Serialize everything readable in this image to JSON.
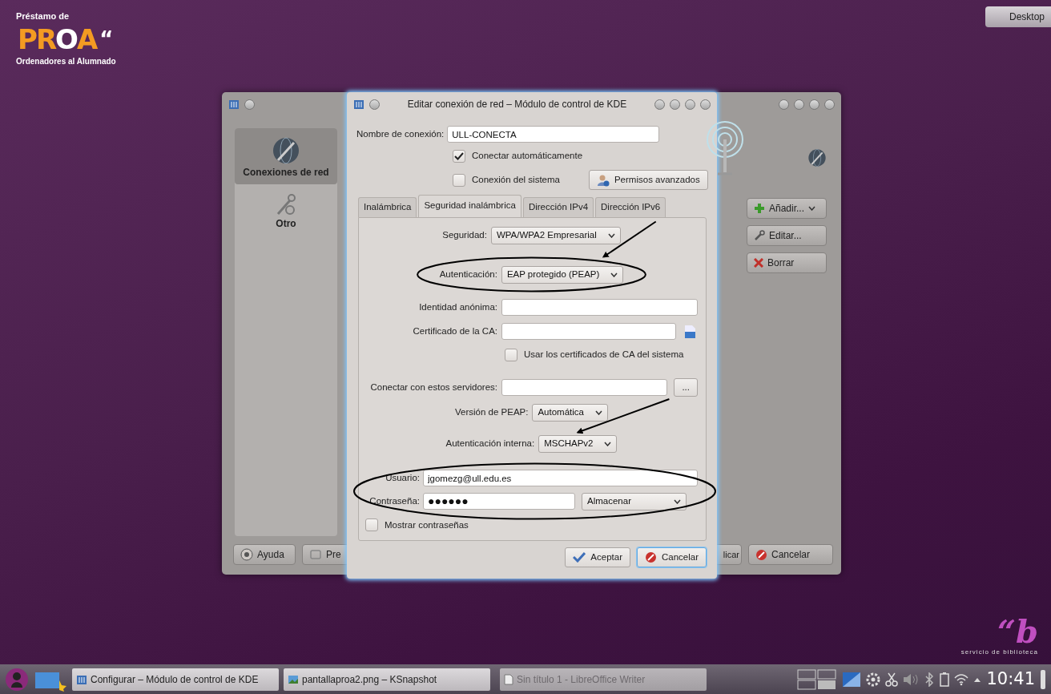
{
  "desktop": {
    "logo": {
      "top_line": "Préstamo de",
      "mark": [
        {
          "text": "PR",
          "color": "#f39b22"
        },
        {
          "text": "O",
          "color": "#ffffff"
        },
        {
          "text": "A",
          "color": "#f39b22"
        }
      ],
      "quote": "“",
      "bottom_line": "Ordenadores al Alumnado"
    },
    "show_desktop": "Desktop",
    "library_logo": {
      "mark": "“b",
      "caption": "servicio de biblioteca"
    }
  },
  "settings_window": {
    "sidebar": [
      {
        "label": "Conexiones de red",
        "kind": "network",
        "selected": true
      },
      {
        "label": "Otro",
        "kind": "tools",
        "selected": false
      }
    ],
    "actions": [
      {
        "label": "Añadir...",
        "kind": "add"
      },
      {
        "label": "Editar...",
        "kind": "edit"
      },
      {
        "label": "Borrar",
        "kind": "delete"
      }
    ],
    "footer_left": [
      {
        "label": "Ayuda",
        "kind": "help"
      },
      {
        "label": "Pre",
        "kind": "reset"
      }
    ],
    "footer_right": [
      {
        "label": "licar",
        "kind": "plain"
      },
      {
        "label": "Cancelar",
        "kind": "cancel"
      }
    ]
  },
  "dialog": {
    "title": "Editar conexión de red – Módulo de control de KDE",
    "connection_name": {
      "label": "Nombre de conexión:",
      "value": "ULL-CONECTA"
    },
    "options": [
      {
        "label": "Conectar automáticamente",
        "checked": true
      },
      {
        "label": "Conexión del sistema",
        "checked": false
      }
    ],
    "permissions_button": "Permisos avanzados",
    "tabs": [
      {
        "label": "Inalámbrica",
        "selected": false
      },
      {
        "label": "Seguridad inalámbrica",
        "selected": true
      },
      {
        "label": "Dirección IPv4",
        "selected": false
      },
      {
        "label": "Dirección IPv6",
        "selected": false
      }
    ],
    "fields": [
      {
        "kind": "select",
        "label": "Seguridad:",
        "value": "WPA/WPA2 Empresarial"
      },
      {
        "kind": "select",
        "label": "Autenticación:",
        "value": "EAP protegido (PEAP)"
      },
      {
        "kind": "text",
        "label": "Identidad anónima:"
      },
      {
        "kind": "file",
        "label": "Certificado de la CA:"
      },
      {
        "kind": "checkbox",
        "label": "Usar los certificados de CA del sistema",
        "checked": false
      },
      {
        "kind": "browse",
        "label": "Conectar con estos servidores:",
        "button": "..."
      },
      {
        "kind": "select",
        "label": "Versión de PEAP:",
        "value": "Automática"
      },
      {
        "kind": "select",
        "label": "Autenticación interna:",
        "value": "MSCHAPv2"
      },
      {
        "kind": "credential",
        "label": "Usuario:",
        "value": "jgomezg@ull.edu.es"
      },
      {
        "kind": "password",
        "label": "Contraseña:",
        "value": "●●●●●●",
        "storage": "Almacenar"
      }
    ],
    "show_passwords": {
      "label": "Mostrar contraseñas",
      "checked": false
    },
    "buttons": [
      {
        "label": "Aceptar",
        "kind": "ok",
        "focused": false
      },
      {
        "label": "Cancelar",
        "kind": "cancel",
        "focused": true
      }
    ]
  },
  "taskbar": {
    "tasks": [
      {
        "label": "Configurar – Módulo de control de KDE",
        "kind": "settings",
        "minimized": false
      },
      {
        "label": "pantallaproa2.png – KSnapshot",
        "kind": "image",
        "minimized": false
      },
      {
        "label": "Sin título 1 - LibreOffice Writer",
        "kind": "document",
        "minimized": true
      }
    ],
    "clock": "10:41"
  }
}
